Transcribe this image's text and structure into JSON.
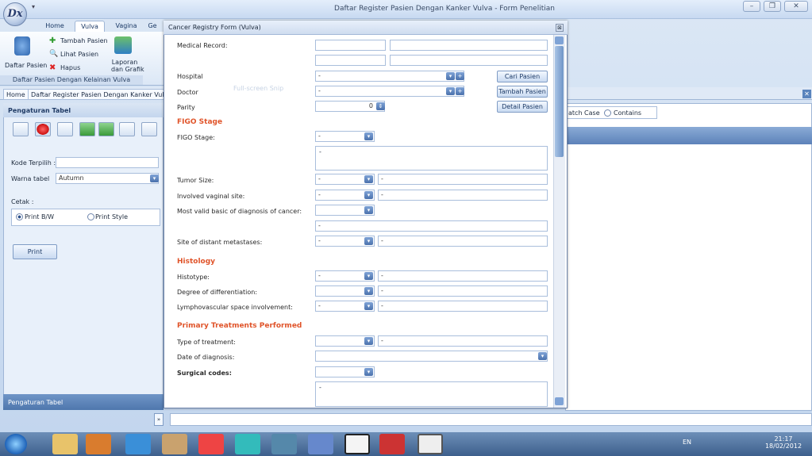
{
  "app_title": "Daftar Register Pasien Dengan Kanker Vulva - Form Penelitian",
  "orb_label": "Dx",
  "ribbon_tabs": [
    "Home",
    "Vulva",
    "Vagina",
    "Ge"
  ],
  "ribbon": {
    "daftar_pasien": "Daftar Pasien",
    "tambah": "Tambah Pasien",
    "lihat": "Lihat Pasien",
    "hapus": "Hapus",
    "laporan": "Laporan",
    "grafik": "dan Grafik",
    "group": "Daftar Pasien Dengan Kelainan Vulva"
  },
  "doc_tabs": [
    "Home",
    "Daftar Register Pasien Dengan Kanker Vulva"
  ],
  "ghost_text": "Full-screen Snip",
  "left": {
    "title": "Pengaturan Tabel",
    "kode": "Kode Terpilih :",
    "warna": "Warna tabel",
    "warna_val": "Autumn",
    "cetak": "Cetak :",
    "bw": "Print B/W",
    "style": "Print Style",
    "print": "Print",
    "footer": "Pengaturan Tabel"
  },
  "right": {
    "match_case": "atch Case",
    "contains": "Contains"
  },
  "dialog": {
    "title": "Cancer Registry Form (Vulva)",
    "medical_record": "Medical Record:",
    "hospital": "Hospital",
    "doctor": "Doctor",
    "parity": "Parity",
    "parity_val": "0",
    "btn_cari": "Cari Pasien",
    "btn_tambah": "Tambah Pasien",
    "btn_detail": "Detail Pasien",
    "dash": "-",
    "figo_section": "FIGO Stage",
    "figo_stage": "FIGO Stage:",
    "tumor_size": "Tumor Size:",
    "involved": "Involved vaginal site:",
    "most_valid": "Most valid basic of diagnosis of cancer:",
    "distant": "Site of distant metastases:",
    "histology_section": "Histology",
    "histotype": "Histotype:",
    "degree": "Degree of differentiation:",
    "lympho": "Lymphovascular space involvement:",
    "primary_section": "Primary Treatments Performed",
    "type_treat": "Type of treatment:",
    "date_diag": "Date of diagnosis:",
    "surgical": "Surgical codes:"
  },
  "clock": {
    "time": "21:17",
    "date": "18/02/2012",
    "lang": "EN"
  }
}
